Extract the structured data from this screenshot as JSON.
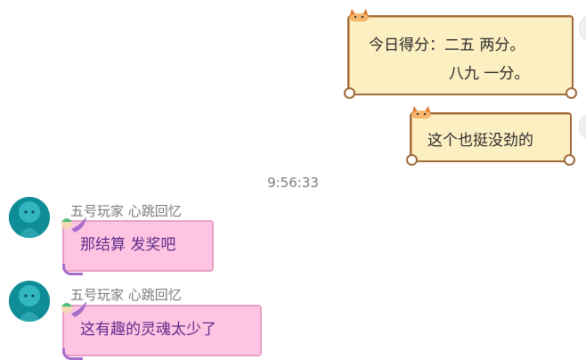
{
  "messages_right": [
    {
      "lines": [
        "今日得分：二五 两分。",
        "八九 一分。"
      ]
    },
    {
      "lines": [
        "这个也挺没劲的"
      ]
    }
  ],
  "timestamp": "9:56:33",
  "messages_left": [
    {
      "nickname": "五号玩家 心跳回忆",
      "text": "那结算 发奖吧"
    },
    {
      "nickname": "五号玩家 心跳回忆",
      "text": "这有趣的灵魂太少了"
    }
  ],
  "colors": {
    "right_bubble_bg": "#fcefc1",
    "right_bubble_border": "#a26b3b",
    "left_bubble_bg": "#ffc4e1",
    "left_bubble_text": "#5e2d8c",
    "avatar_teal": "#0f8d96"
  },
  "icons": [
    "cat-sticker-icon",
    "mermaid-sticker-icon",
    "avatar-teal-doll"
  ]
}
